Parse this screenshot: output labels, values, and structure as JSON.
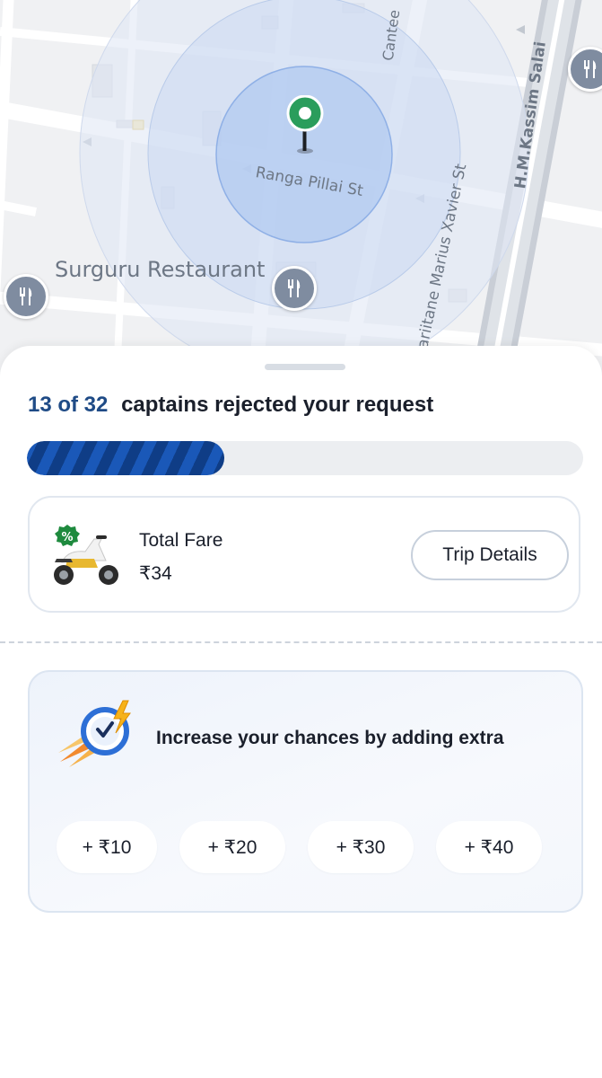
{
  "map": {
    "streets": [
      "Ranga Pillai St",
      "Surguru Restaurant",
      "Mariitane Marius Xavier St",
      "H.M.Kassim Salai",
      "Cantee"
    ],
    "icons": [
      "location-pin-icon",
      "restaurant-icon"
    ]
  },
  "request": {
    "rejected_count": "13 of 32",
    "status_text": "captains rejected your request",
    "progress_fraction": 0.355
  },
  "fare": {
    "label": "Total Fare",
    "amount": "₹34",
    "trip_details_button": "Trip Details",
    "icon": "bike-discount-icon"
  },
  "extra": {
    "title": "Increase your chances by adding extra",
    "icon": "clock-bolt-icon",
    "options": [
      "+ ₹10",
      "+ ₹20",
      "+ ₹30",
      "+ ₹40"
    ]
  },
  "colors": {
    "accent": "#1f4b86",
    "progress_dark": "#0f3d86",
    "progress_light": "#1a58b8",
    "pin": "#2a9d5c"
  }
}
